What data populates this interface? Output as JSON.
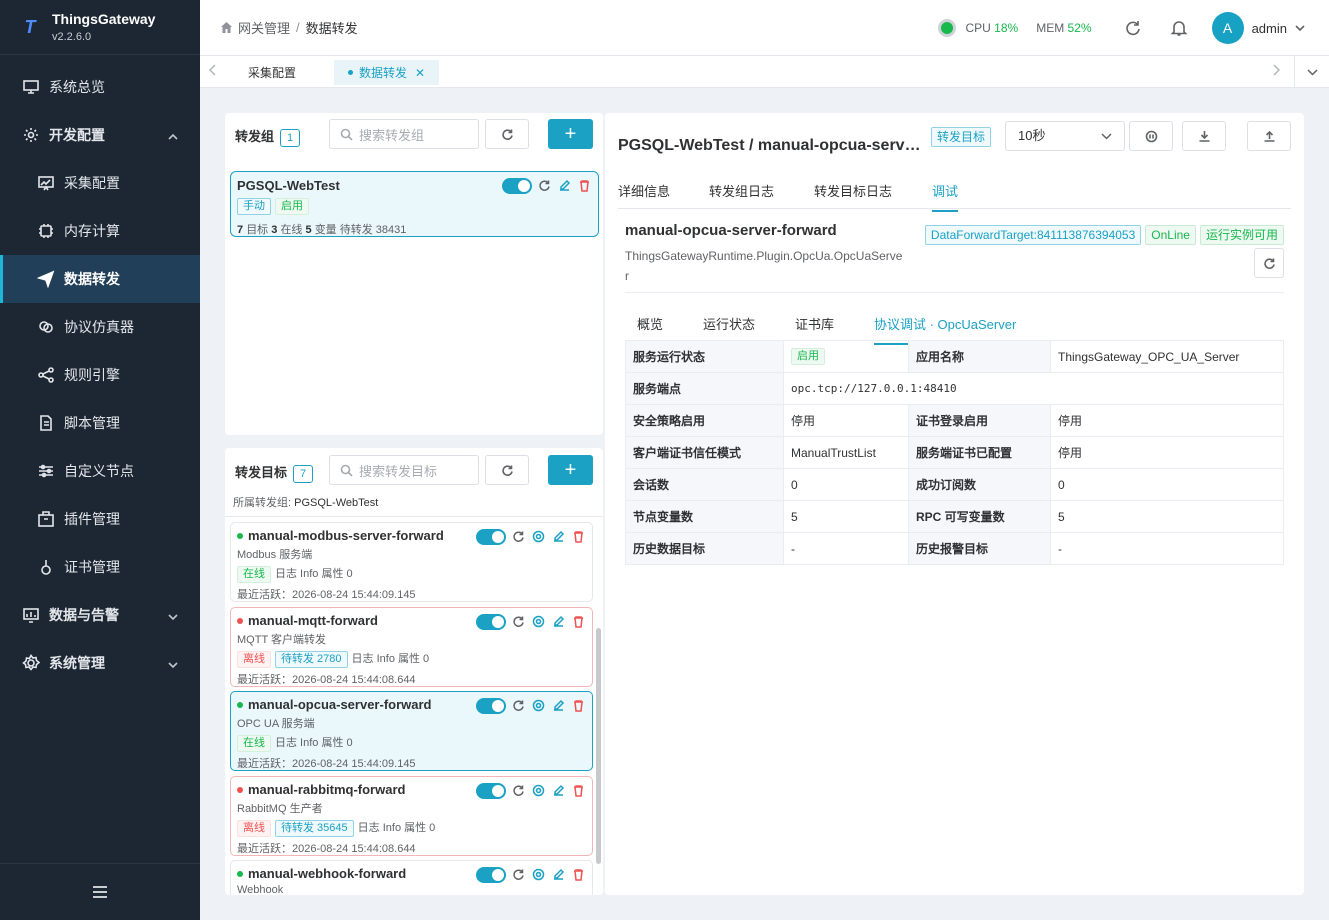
{
  "app": {
    "name": "ThingsGateway",
    "version": "v2.2.6.0"
  },
  "sidebar": {
    "items": [
      {
        "label": "系统总览"
      },
      {
        "label": "开发配置"
      },
      {
        "label": "采集配置"
      },
      {
        "label": "内存计算"
      },
      {
        "label": "数据转发"
      },
      {
        "label": "协议仿真器"
      },
      {
        "label": "规则引擎"
      },
      {
        "label": "脚本管理"
      },
      {
        "label": "自定义节点"
      },
      {
        "label": "插件管理"
      },
      {
        "label": "证书管理"
      },
      {
        "label": "数据与告警"
      },
      {
        "label": "系统管理"
      }
    ]
  },
  "header": {
    "breadcrumb": [
      "网关管理",
      "/",
      "数据转发"
    ],
    "cpu_label": "CPU",
    "cpu_value": "18%",
    "mem_label": "MEM",
    "mem_value": "52%",
    "avatar_letter": "A",
    "username": "admin"
  },
  "page_tabs": [
    {
      "label": "采集配置",
      "active": false
    },
    {
      "label": "数据转发",
      "active": true,
      "close": "✕"
    }
  ],
  "groups_panel": {
    "title": "转发组",
    "count": "1",
    "search_placeholder": "搜索转发组",
    "add": "+",
    "group": {
      "name": "PGSQL-WebTest",
      "tags": [
        "手动",
        "启用"
      ],
      "stat": {
        "targets": "7",
        "targets_label": "目标",
        "online": "3",
        "online_label": "在线",
        "vars": "5",
        "vars_label": "变量",
        "pending": "待转发 38431"
      }
    }
  },
  "targets_panel": {
    "title": "转发目标",
    "count": "7",
    "search_placeholder": "搜索转发目标",
    "add": "+",
    "group_label": "所属转发组:",
    "group_value": "PGSQL-WebTest",
    "items": [
      {
        "name": "manual-modbus-server-forward",
        "sub": "Modbus 服务端",
        "status": "在线",
        "pending": "",
        "log": "日志 Info",
        "attr": "属性 0",
        "last": "最近活跃：2026-08-24 15:44:09.145"
      },
      {
        "name": "manual-mqtt-forward",
        "sub": "MQTT 客户端转发",
        "status": "离线",
        "pending": "待转发 2780",
        "log": "日志 Info",
        "attr": "属性 0",
        "last": "最近活跃：2026-08-24 15:44:08.644"
      },
      {
        "name": "manual-opcua-server-forward",
        "sub": "OPC UA 服务端",
        "status": "在线",
        "pending": "",
        "log": "日志 Info",
        "attr": "属性 0",
        "last": "最近活跃：2026-08-24 15:44:09.145"
      },
      {
        "name": "manual-rabbitmq-forward",
        "sub": "RabbitMQ 生产者",
        "status": "离线",
        "pending": "待转发 35645",
        "log": "日志 Info",
        "attr": "属性 0",
        "last": "最近活跃：2026-08-24 15:44:08.644"
      },
      {
        "name": "manual-webhook-forward",
        "sub": "Webhook",
        "status": "",
        "pending": "",
        "log": "",
        "attr": "",
        "last": ""
      }
    ]
  },
  "detail": {
    "title": "PGSQL-WebTest / manual-opcua-server-forward",
    "title_tag": "转发目标",
    "interval": "10秒",
    "tabs": [
      "详细信息",
      "转发组日志",
      "转发目标日志",
      "调试"
    ],
    "target_name": "manual-opcua-server-forward",
    "plugin": "ThingsGatewayRuntime.Plugin.OpcUa.OpcUaServer",
    "id_tag": "DataForwardTarget:841113876394053",
    "online_tag": "OnLine",
    "runtime_tag": "运行实例可用",
    "subtabs": [
      "概览",
      "运行状态",
      "证书库",
      "协议调试 · OpcUaServer"
    ],
    "rows": [
      {
        "k1": "服务运行状态",
        "v1": "启用",
        "k2": "应用名称",
        "v2": "ThingsGateway_OPC_UA_Server"
      },
      {
        "k1": "服务端点",
        "v1": "opc.tcp://127.0.0.1:48410"
      },
      {
        "k1": "安全策略启用",
        "v1": "停用",
        "k2": "证书登录启用",
        "v2": "停用"
      },
      {
        "k1": "客户端证书信任模式",
        "v1": "ManualTrustList",
        "k2": "服务端证书已配置",
        "v2": "停用"
      },
      {
        "k1": "会话数",
        "v1": "0",
        "k2": "成功订阅数",
        "v2": "0"
      },
      {
        "k1": "节点变量数",
        "v1": "5",
        "k2": "RPC 可写变量数",
        "v2": "5"
      },
      {
        "k1": "历史数据目标",
        "v1": "-",
        "k2": "历史报警目标",
        "v2": "-"
      }
    ]
  }
}
